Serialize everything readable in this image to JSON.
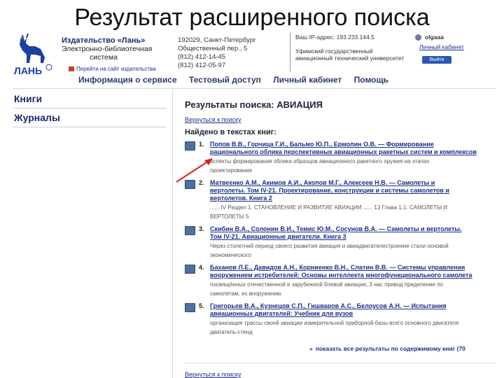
{
  "slide_title": "Результат расширенного поиска",
  "header": {
    "publisher_name": "Издательство «Лань»",
    "publisher_line2": "Электронно-библиотечная",
    "publisher_line3": "система",
    "home_link": "Перейти на сайт издательства",
    "address_line1": "192029, Санкт-Петербург",
    "address_line2": "Общественный пер., 5",
    "phone1": "(812) 412-14-45",
    "phone2": "(812) 412-05-97",
    "ip": "Ваш IP-адрес: 193.233.144.5",
    "org_line1": "Уфимский государственный",
    "org_line2": "авиационный технический университет",
    "username": "olgaaa",
    "cabinet_link": "Личный кабинет",
    "exit_button": "Выйти"
  },
  "nav": {
    "items": [
      "Информация о сервисе",
      "Тестовый доступ",
      "Личный кабинет",
      "Помощь"
    ]
  },
  "sidebar": {
    "items": [
      "Книги",
      "Журналы"
    ]
  },
  "main": {
    "title": "Результаты поиска: АВИАЦИЯ",
    "back_link": "Вернуться к поиску",
    "found_label": "Найдено в текстах книг:",
    "results": [
      {
        "num": "1.",
        "title1": "Попов В.В., Горчица Г.И., Бальмо Ю.П., Ермолин О.В. — Формирование",
        "title2": "рационального облика перспективных авиационных ракетных систем и комплексов",
        "snip1": "аспекты формирования облика образцов авиационного ракетного оружия на этапах",
        "snip2": "проектирования"
      },
      {
        "num": "2.",
        "title1": "Матвеенко А.М., Акимов А.И., Акопов М.Г., Алексеев Н.В. — Самолеты и",
        "title2": "вертолеты. Том IV-21. Проектирование, конструкции и системы самолетов и",
        "title3": "вертолетов. Книга 2",
        "snip1": "...... IV Раздел 1. СТАНОВЛЕНИЕ И РАЗВИТИЕ АВИАЦИИ ...... 13 Глава 1.1. САМОЛЕТЫ И",
        "snip2": "ВЕРТОЛЕТЫ 5"
      },
      {
        "num": "3.",
        "title1": "Скибин В.А., Солонин В.И., Темис Ю.М., Сосунов В.А. — Самолеты и вертолеты.",
        "title2": "Том IV-21. Авиационные двигатели. Книга 3",
        "snip1": "Через столетний период своего развития авиация и авиадвигателестроение стали основой",
        "snip2": "экономического"
      },
      {
        "num": "4.",
        "title1": "Баханов Л.Е., Давидов А.Н., Корниенко В.Н., Слатин В.В. — Системы управления",
        "title2": "вооружением истребителей: Основы интеллекта многофункционального самолета",
        "snip1": "посвящённых отечественной и зарубежной боевой авиации, 3 нас привод пределение по",
        "snip2": "самолетам, их вооружению"
      },
      {
        "num": "5.",
        "title1": "Григорьев В.А., Кузнецов С.П., Гишваров А.С., Белоусов А.Н. — Испытания",
        "title2": "авиационных двигателей: Учебник для вузов",
        "snip1": "организация трассы своей авиации измерительной приборной базы всего основного двигателя",
        "snip2": "двигатель-стенд"
      }
    ],
    "more_link": "показать все результаты по содержимому книг (70",
    "back_link_bottom": "Вернуться к поиску"
  }
}
